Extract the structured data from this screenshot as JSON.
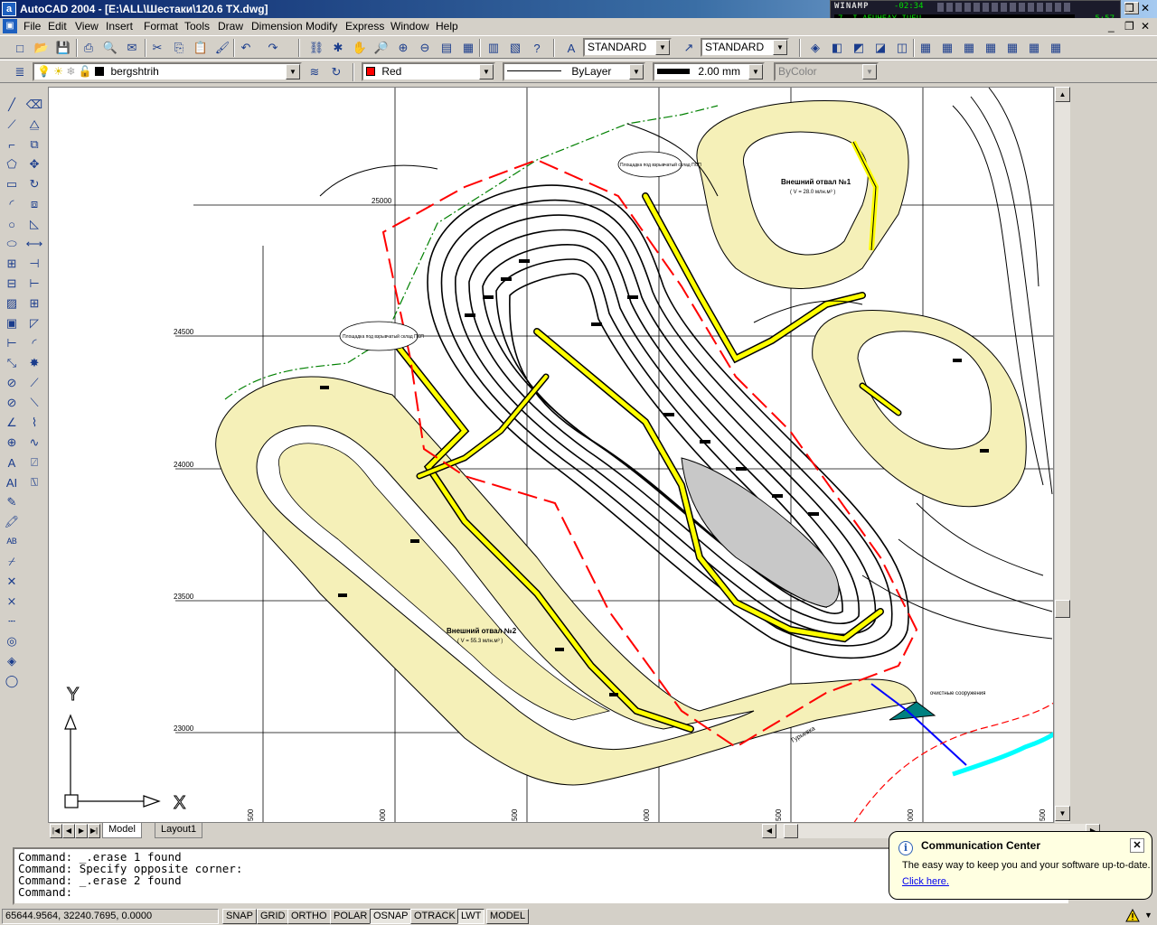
{
  "window": {
    "title": "AutoCAD 2004 - [E:\\ALL\\Шестаки\\120.6 TX.dwg]",
    "app_icon": "autocad-icon",
    "controls": [
      "minimize",
      "restore",
      "close"
    ]
  },
  "winamp": {
    "title": "WINAMP",
    "elapsed": "-02:34",
    "track": "7. I AEUHEAY IUEU",
    "length": "5:57"
  },
  "menu": [
    "File",
    "Edit",
    "View",
    "Insert",
    "Format",
    "Tools",
    "Draw",
    "Dimension",
    "Modify",
    "Express",
    "Window",
    "Help"
  ],
  "standard_toolbar": {
    "text_style": "STANDARD",
    "dim_style": "STANDARD"
  },
  "properties_toolbar": {
    "layer": "bergshtrih",
    "color": "Red",
    "color_hex": "#ff0000",
    "linetype": "ByLayer",
    "lineweight": "2.00 mm",
    "plot_style": "ByColor"
  },
  "drawing": {
    "grid_y_labels": [
      "25000",
      "24500",
      "24000",
      "23500",
      "23000"
    ],
    "grid_x_labels": [
      "500",
      "000",
      "500",
      "000",
      "500",
      "000",
      "500"
    ],
    "labels": {
      "dump1_title": "Внешний отвал №1",
      "dump1_sub": "( V = 28.0 млн.м³ )",
      "dump2_title": "Внешний отвал №2",
      "dump2_sub": "( V = 55.3 млн.м³ )",
      "site1": "Площадка под взрывчатый склад ПСП",
      "site2": "Площадка под взрывчатый склад ПСП",
      "facility": "очистные сооружения",
      "river": "Гурьевка"
    },
    "ucs": {
      "x": "X",
      "y": "Y"
    },
    "colors": {
      "contours": "#000000",
      "road_fill": "#f5f0b8",
      "road_highlight": "#ffff00",
      "boundary": "#ff0000",
      "green_boundary": "#008000",
      "river": "#00ffff",
      "pipe": "#0000ff"
    }
  },
  "layout_tabs": [
    "Model",
    "Layout1"
  ],
  "active_tab": "Model",
  "command_history": [
    "Command: _.erase 1 found",
    "Command: Specify opposite corner:",
    "Command: _.erase 2 found",
    "Command:"
  ],
  "status": {
    "coordinates": "65644.9564, 32240.7695, 0.0000",
    "toggles": [
      {
        "label": "SNAP",
        "on": false
      },
      {
        "label": "GRID",
        "on": false
      },
      {
        "label": "ORTHO",
        "on": false
      },
      {
        "label": "POLAR",
        "on": false
      },
      {
        "label": "OSNAP",
        "on": true
      },
      {
        "label": "OTRACK",
        "on": false
      },
      {
        "label": "LWT",
        "on": true
      },
      {
        "label": "MODEL",
        "on": false
      }
    ]
  },
  "balloon": {
    "title": "Communication Center",
    "message": "The easy way to keep you and your software up-to-date.",
    "link": "Click here."
  }
}
